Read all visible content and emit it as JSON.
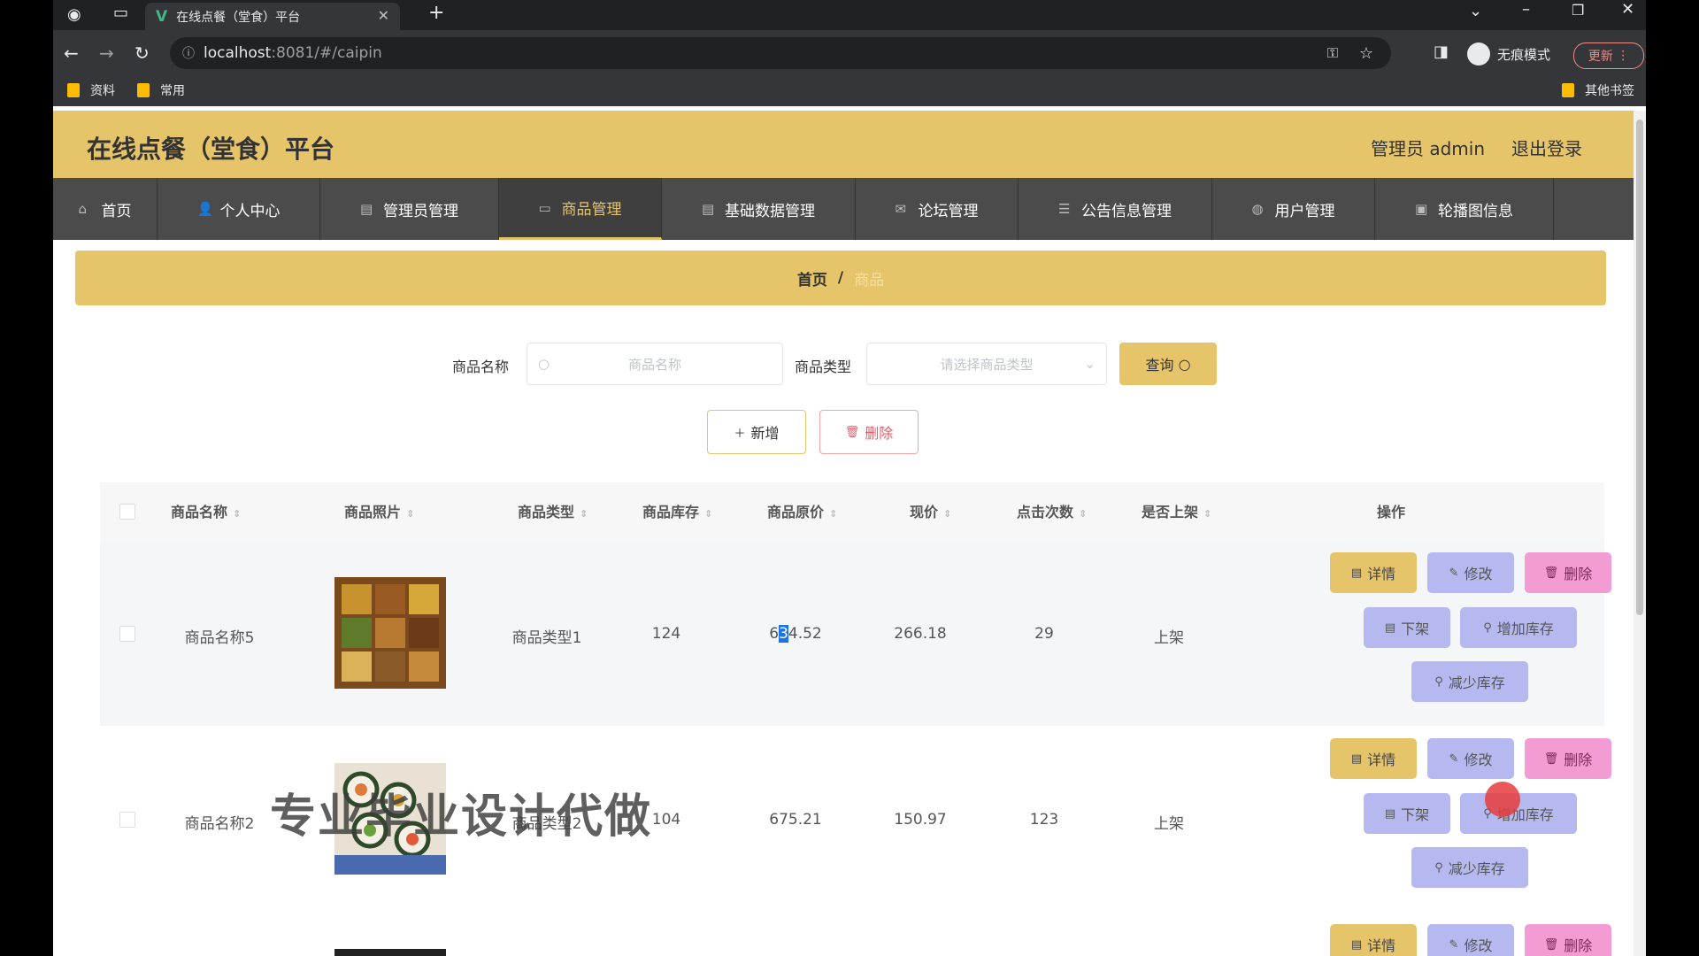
{
  "browser": {
    "tab_title": "在线点餐（堂食）平台",
    "url_host": "localhost",
    "url_rest": ":8081/#/caipin",
    "incognito_label": "无痕模式",
    "update_label": "更新",
    "bookmarks": [
      "资料",
      "常用"
    ],
    "other_bookmarks": "其他书签"
  },
  "header": {
    "title": "在线点餐（堂食）平台",
    "admin": "管理员 admin",
    "logout": "退出登录"
  },
  "menu": [
    {
      "label": "首页",
      "icon": "home-icon"
    },
    {
      "label": "个人中心",
      "icon": "user-icon"
    },
    {
      "label": "管理员管理",
      "icon": "doc-icon"
    },
    {
      "label": "商品管理",
      "icon": "monitor-icon",
      "active": true
    },
    {
      "label": "基础数据管理",
      "icon": "doc-icon"
    },
    {
      "label": "论坛管理",
      "icon": "mail-icon"
    },
    {
      "label": "公告信息管理",
      "icon": "list-icon"
    },
    {
      "label": "用户管理",
      "icon": "globe-icon"
    },
    {
      "label": "轮播图信息",
      "icon": "image-icon"
    }
  ],
  "breadcrumb": {
    "home": "首页",
    "sep": "/",
    "current": "商品"
  },
  "search": {
    "name_label": "商品名称",
    "name_placeholder": "商品名称",
    "type_label": "商品类型",
    "type_placeholder": "请选择商品类型",
    "query_label": "查询"
  },
  "actions": {
    "add_label": "新增",
    "delete_label": "删除"
  },
  "table": {
    "headers": [
      "商品名称",
      "商品照片",
      "商品类型",
      "商品库存",
      "商品原价",
      "现价",
      "点击次数",
      "是否上架",
      "操作"
    ],
    "buttons": {
      "detail": "详情",
      "edit": "修改",
      "delete": "删除",
      "off_shelf": "下架",
      "add_stock": "增加库存",
      "reduce_stock": "减少库存"
    },
    "rows": [
      {
        "name": "商品名称5",
        "type": "商品类型1",
        "stock": "124",
        "orig_price_a": "6",
        "orig_price_b": "3",
        "orig_price_c": "4.52",
        "price": "266.18",
        "clicks": "29",
        "on_shelf": "上架"
      },
      {
        "name": "商品名称2",
        "type": "商品类型2",
        "stock": "104",
        "orig_price": "675.21",
        "price": "150.97",
        "clicks": "123",
        "on_shelf": "上架"
      }
    ]
  },
  "watermark": "专业毕业设计代做"
}
